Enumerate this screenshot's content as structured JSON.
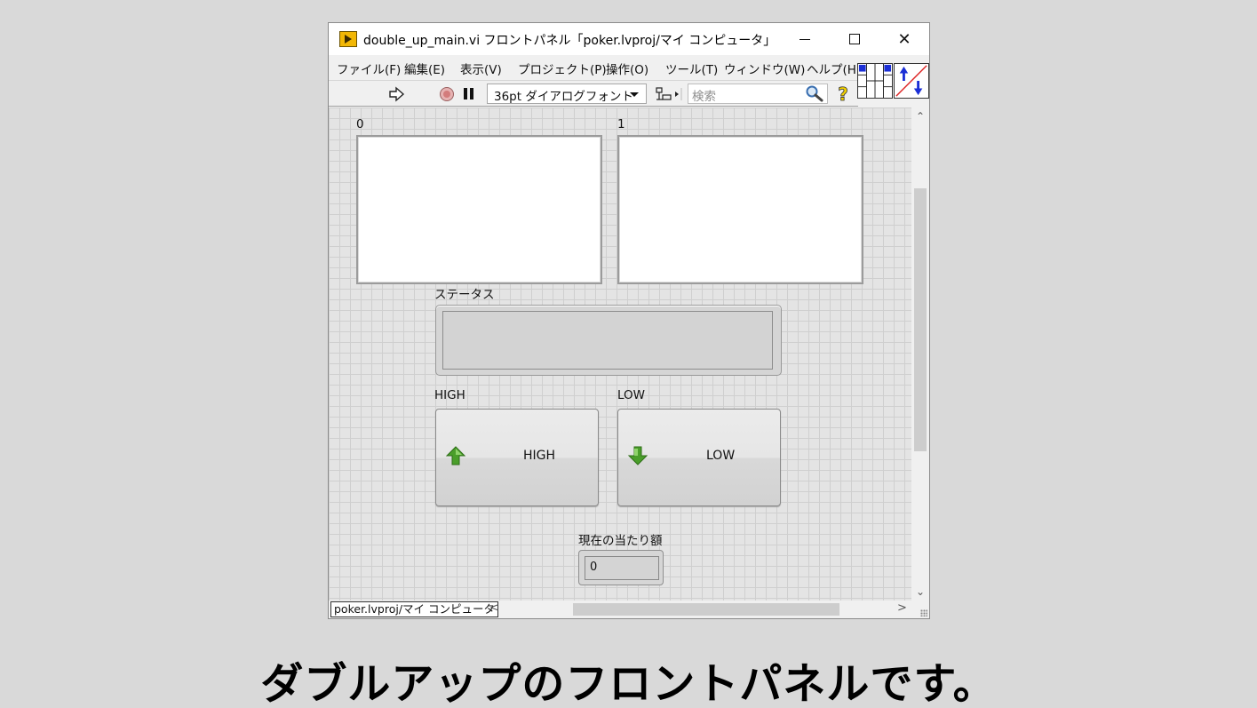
{
  "window": {
    "title": "double_up_main.vi フロントパネル「poker.lvproj/マイ コンピュータ」",
    "controls": {
      "minimize": "minimize",
      "maximize": "maximize",
      "close": "✕"
    }
  },
  "menu": {
    "items": [
      "ファイル(F)",
      "編集(E)",
      "表示(V)",
      "プロジェクト(P)",
      "操作(O)",
      "ツール(T)",
      "ウィンドウ(W)",
      "ヘルプ(H)"
    ]
  },
  "toolbar": {
    "font_selected": "36pt ダイアログフォント",
    "search_placeholder": "検索",
    "icons": [
      "run-arrow-icon",
      "abort-icon",
      "pause-icon",
      "align-objects-icon",
      "search-icon",
      "help-icon"
    ]
  },
  "panel": {
    "picture_left_label": "0",
    "picture_right_label": "1",
    "status_label": "ステータス",
    "status_value": "",
    "high_label": "HIGH",
    "high_button_text": "HIGH",
    "low_label": "LOW",
    "low_button_text": "LOW",
    "amount_label": "現在の当たり額",
    "amount_value": "0"
  },
  "bottombar": {
    "context": "poker.lvproj/マイ コンピュータ"
  },
  "caption": "ダブルアップのフロントパネルです。",
  "colors": {
    "high_arrow": "#4a9e2a",
    "low_arrow": "#4a9e2a",
    "grid": "#cfcfcf",
    "panel_bg": "#e4e4e4"
  }
}
